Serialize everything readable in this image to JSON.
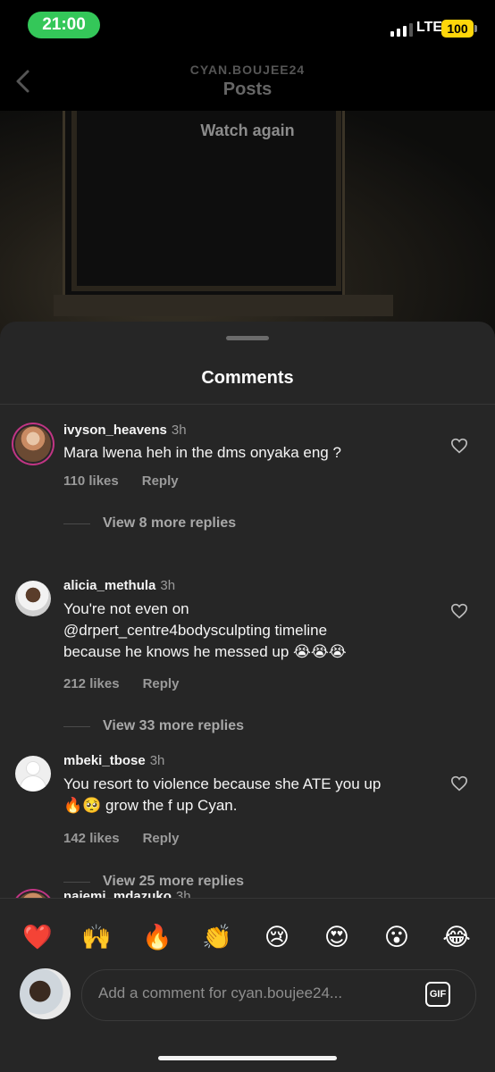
{
  "status_bar": {
    "time": "21:00",
    "network": "LTE",
    "battery": "100"
  },
  "header": {
    "username": "CYAN.BOUJEE24",
    "title": "Posts"
  },
  "video": {
    "watch_again": "Watch again"
  },
  "sheet": {
    "title": "Comments"
  },
  "comments": [
    {
      "username": "ivyson_heavens",
      "time": "3h",
      "lines": [
        "Mara lwena heh in the dms onyaka eng ?"
      ],
      "likes": "110 likes",
      "reply": "Reply",
      "more_replies": "View 8 more replies"
    },
    {
      "username": "alicia_methula",
      "time": "3h",
      "lines": [
        "You're not even on",
        "@drpert_centre4bodysculpting timeline",
        "because he knows he messed up 😭😭😭"
      ],
      "likes": "212 likes",
      "reply": "Reply",
      "more_replies": "View 33 more replies"
    },
    {
      "username": "mbeki_tbose",
      "time": "3h",
      "lines": [
        "You resort to violence because she ATE you up",
        "🔥🥺 grow the f up Cyan."
      ],
      "likes": "142 likes",
      "reply": "Reply",
      "more_replies": "View 25 more replies"
    },
    {
      "username": "naiemi_mdazuko",
      "time": "3h"
    }
  ],
  "emoji_bar": [
    "❤️",
    "🙌",
    "🔥",
    "👏",
    "😢",
    "😍",
    "😮",
    "😂"
  ],
  "input": {
    "placeholder": "Add a comment for cyan.boujee24...",
    "gif_label": "GIF"
  },
  "colors": {
    "sheet": "#262626",
    "status_pill": "#34c759",
    "battery": "#ffd60a",
    "story_ring": "#c13584"
  }
}
